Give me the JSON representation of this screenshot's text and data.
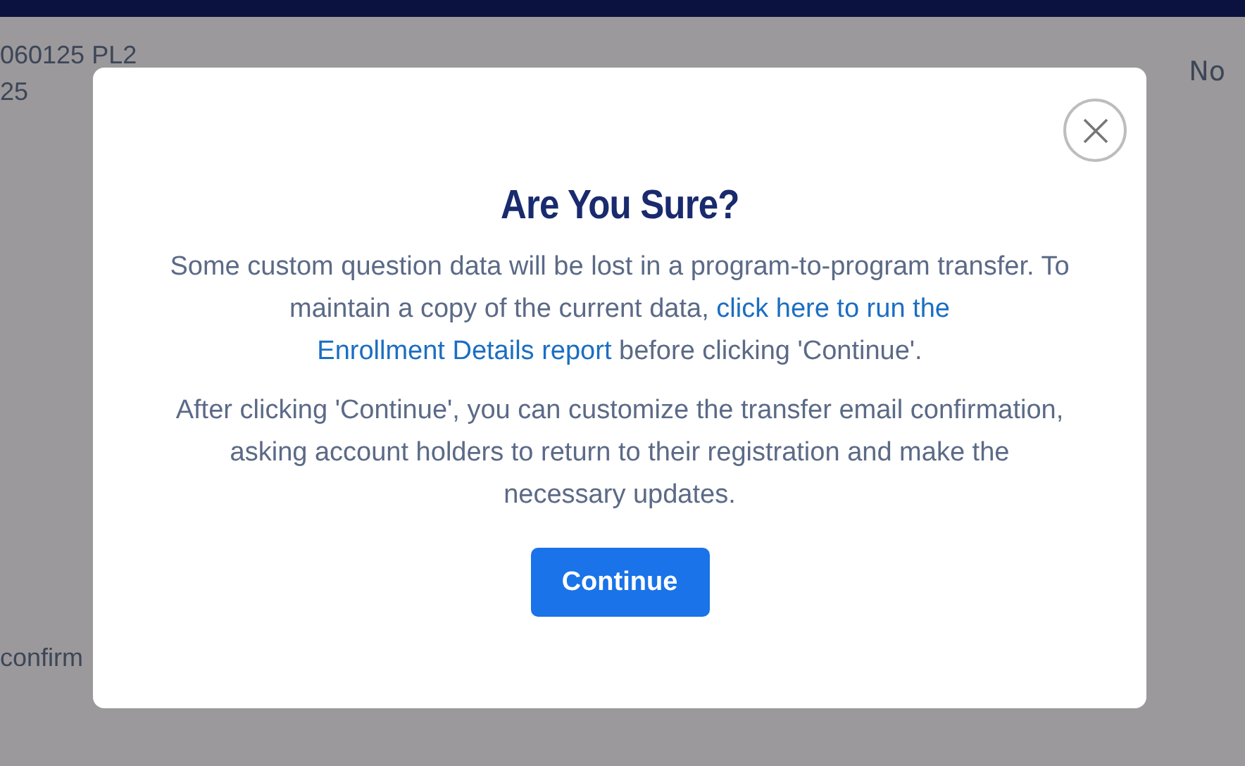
{
  "background_table": {
    "row_1": {
      "column_1": [
        "060125 PL2",
        "25"
      ],
      "column_last": "No"
    },
    "row_2": {
      "column_1": "confirm"
    }
  },
  "dialog": {
    "title": "Are You Sure?",
    "paragraphs": [
      {
        "text_before": "Some custom question data will be lost in a program-to-program transfer. To maintain a copy of the current data,",
        "link_parts": [
          "click here to run the",
          "Enrollment Details report"
        ],
        "text_after": "before clicking 'Continue'."
      },
      {
        "text_before": "After clicking 'Continue', you can customize the transfer email confirmation, asking account holders to return to their registration and make the necessary updates."
      }
    ],
    "button": "Continue"
  }
}
